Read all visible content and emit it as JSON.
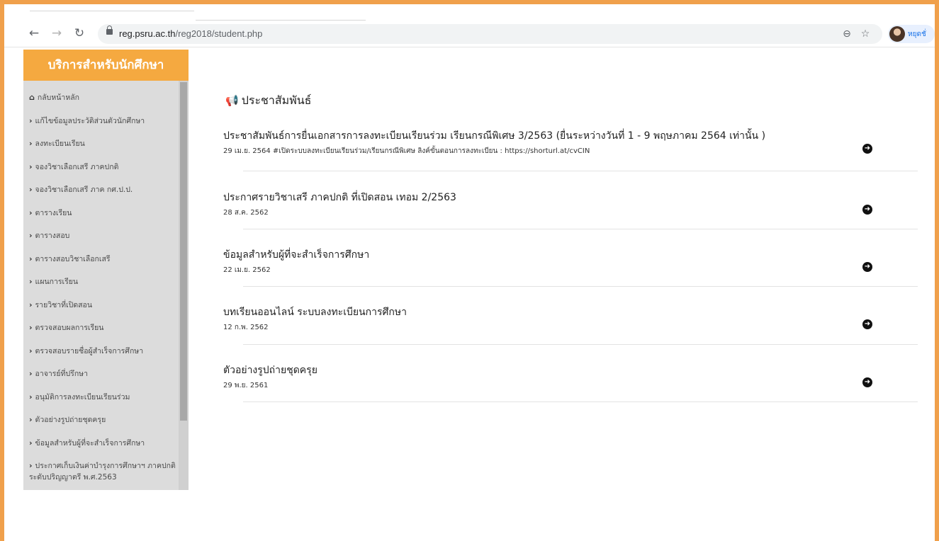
{
  "browser": {
    "url_host": "reg.psru.ac.th",
    "url_path": "/reg2018/student.php",
    "profile_label": "หยุดชั่"
  },
  "sidebar": {
    "header": "บริการสำหรับนักศึกษา",
    "items": [
      {
        "icon": "home-icon",
        "label": "กลับหน้าหลัก"
      },
      {
        "icon": "chevron-right-icon",
        "label": "แก้ไขข้อมูลประวัติส่วนตัวนักศึกษา"
      },
      {
        "icon": "chevron-right-icon",
        "label": "ลงทะเบียนเรียน"
      },
      {
        "icon": "chevron-right-icon",
        "label": "จองวิชาเลือกเสรี ภาคปกติ"
      },
      {
        "icon": "chevron-right-icon",
        "label": "จองวิชาเลือกเสรี ภาค กศ.ป.ป."
      },
      {
        "icon": "chevron-right-icon",
        "label": "ตารางเรียน"
      },
      {
        "icon": "chevron-right-icon",
        "label": "ตารางสอบ"
      },
      {
        "icon": "chevron-right-icon",
        "label": "ตารางสอบวิชาเลือกเสรี"
      },
      {
        "icon": "chevron-right-icon",
        "label": "แผนการเรียน"
      },
      {
        "icon": "chevron-right-icon",
        "label": "รายวิชาที่เปิดสอน"
      },
      {
        "icon": "chevron-right-icon",
        "label": "ตรวจสอบผลการเรียน"
      },
      {
        "icon": "chevron-right-icon",
        "label": "ตรวจสอบรายชื่อผู้สำเร็จการศึกษา"
      },
      {
        "icon": "chevron-right-icon",
        "label": "อาจารย์ที่ปรึกษา"
      },
      {
        "icon": "chevron-right-icon",
        "label": "อนุมัติการลงทะเบียนเรียนร่วม"
      },
      {
        "icon": "chevron-right-icon",
        "label": "ตัวอย่างรูปถ่ายชุดครุย"
      },
      {
        "icon": "chevron-right-icon",
        "label": "ข้อมูลสำหรับผู้ที่จะสำเร็จการศึกษา"
      },
      {
        "icon": "chevron-right-icon",
        "label": "ประกาศเก็บเงินค่าบำรุงการศึกษาฯ ภาคปกติ ระดับปริญญาตรี พ.ศ.2563"
      }
    ]
  },
  "main": {
    "title": "ประชาสัมพันธ์",
    "news": [
      {
        "title": "ประชาสัมพันธ์การยื่นเอกสารการลงทะเบียนเรียนร่วม เรียนกรณีพิเศษ 3/2563 (ยื่นระหว่างวันที่ 1 - 9 พฤษภาคม 2564 เท่านั้น )",
        "meta": "29 เม.ย. 2564    #เปิดระบบลงทะเบียนเรียนร่วม/เรียนกรณีพิเศษ ลิงค์ขั้นตอนการลงทะเบียน : https://shorturl.at/cvCIN"
      },
      {
        "title": "ประกาศรายวิชาเสรี ภาคปกติ ที่เปิดสอน เทอม 2/2563",
        "meta": "28 ส.ค. 2562"
      },
      {
        "title": "ข้อมูลสำหรับผู้ที่จะสำเร็จการศึกษา",
        "meta": "22 เม.ย. 2562"
      },
      {
        "title": "บทเรียนออนไลน์ ระบบลงทะเบียนการศึกษา",
        "meta": "12 ก.พ. 2562"
      },
      {
        "title": "ตัวอย่างรูปถ่ายชุดครุย",
        "meta": "29 พ.ย. 2561"
      }
    ]
  },
  "colors": {
    "accent": "#f5a940",
    "frame": "#f0a04b",
    "sidebar_bg": "#dcdcdc"
  }
}
